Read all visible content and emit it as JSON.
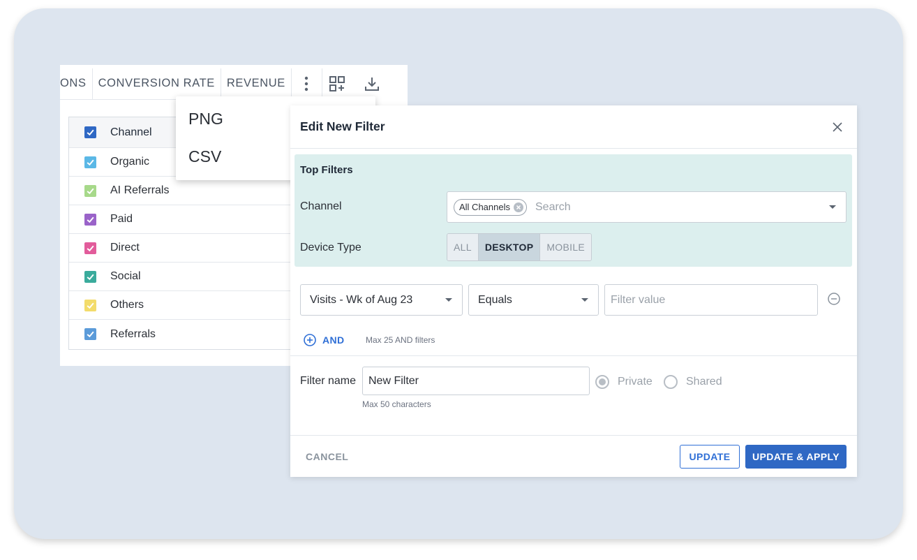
{
  "table_header": {
    "columns": [
      "ONS",
      "CONVERSION RATE",
      "REVENUE"
    ]
  },
  "table": {
    "header_label": "Channel",
    "rows": [
      {
        "label": "Organic",
        "color": "#5bb8e6"
      },
      {
        "label": "AI Referrals",
        "color": "#a7d98a"
      },
      {
        "label": "Paid",
        "color": "#9a63c9"
      },
      {
        "label": "Direct",
        "color": "#e25c9b"
      },
      {
        "label": "Social",
        "color": "#3aab9c"
      },
      {
        "label": "Others",
        "color": "#f3dc6b"
      },
      {
        "label": "Referrals",
        "color": "#5b9bd9"
      }
    ],
    "header_color": "#2f68c4"
  },
  "export_menu": {
    "items": [
      "PNG",
      "CSV"
    ]
  },
  "modal": {
    "title": "Edit New Filter",
    "top_filters": {
      "title": "Top Filters",
      "channel_label": "Channel",
      "channel_chip": "All Channels",
      "channel_placeholder": "Search",
      "device_label": "Device Type",
      "device_options": [
        "ALL",
        "DESKTOP",
        "MOBILE"
      ],
      "device_selected": "DESKTOP"
    },
    "condition": {
      "metric": "Visits - Wk of Aug 23",
      "operator": "Equals",
      "value_placeholder": "Filter value"
    },
    "and_label": "AND",
    "and_hint": "Max 25 AND filters",
    "filter_name_label": "Filter name",
    "filter_name_value": "New Filter",
    "filter_name_hint": "Max 50 characters",
    "visibility": {
      "private_label": "Private",
      "shared_label": "Shared",
      "selected": "Private"
    },
    "buttons": {
      "cancel": "CANCEL",
      "update": "UPDATE",
      "update_apply": "UPDATE & APPLY"
    }
  },
  "colors": {
    "accent": "#2f68c4",
    "frame_bg": "#dde5ef",
    "top_filters_bg": "#dcefee"
  }
}
